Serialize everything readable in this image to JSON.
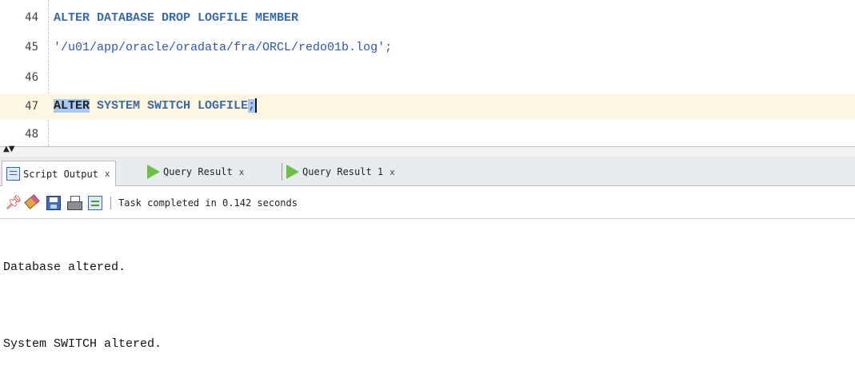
{
  "editor": {
    "lines": [
      {
        "num": "44",
        "text": "ALTER DATABASE DROP LOGFILE MEMBER"
      },
      {
        "num": "45",
        "text": "'/u01/app/oracle/oradata/fra/ORCL/redo01b.log';"
      },
      {
        "num": "46",
        "text": ""
      },
      {
        "num": "47",
        "selected": "ALTER",
        "rest": " SYSTEM SWITCH LOGFILE",
        "semicolon": ";"
      },
      {
        "num": "48",
        "text": ""
      }
    ]
  },
  "splitter": {
    "arrows": "▲▼"
  },
  "tabs": [
    {
      "label": "Script Output",
      "close": "x",
      "icon": "script-doc-icon"
    },
    {
      "label": "Query Result",
      "close": "x",
      "icon": "play-icon"
    },
    {
      "label": "Query Result 1",
      "close": "x",
      "icon": "play-icon"
    }
  ],
  "toolbar": {
    "icons": [
      "pin-icon",
      "eraser-icon",
      "save-icon",
      "print-icon",
      "document-icon"
    ],
    "status": "Task completed in 0.142 seconds"
  },
  "output": {
    "lines": [
      "Database altered.",
      "System SWITCH altered."
    ]
  },
  "colors": {
    "current_line": "#fdf6e1",
    "selection": "#a8c8f0",
    "keyword": "#3a6aa8",
    "string": "#2c56b8"
  }
}
